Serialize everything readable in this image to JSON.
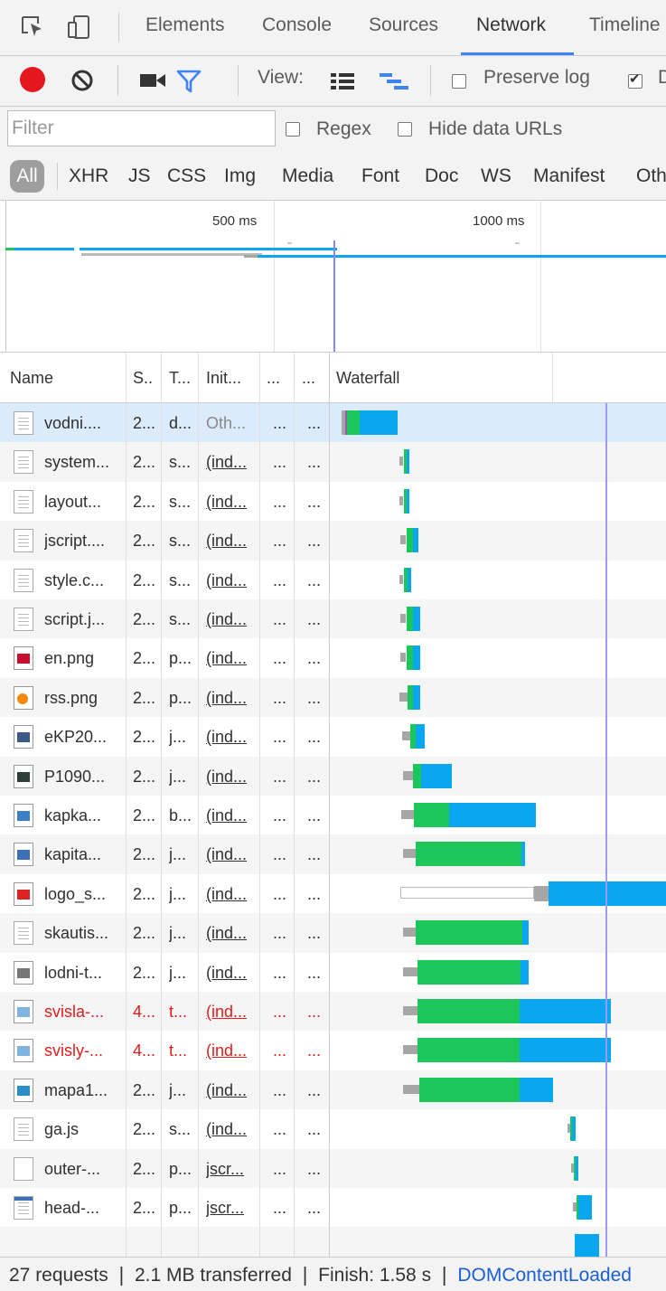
{
  "tabs": {
    "items": [
      "Elements",
      "Console",
      "Sources",
      "Network",
      "Timeline"
    ],
    "active": "Network"
  },
  "toolbar": {
    "view_label": "View:",
    "preserve_log_label": "Preserve log",
    "preserve_log_checked": false,
    "second_checkbox_checked": true,
    "second_checkbox_partial_label": "D",
    "record_color": "#e4171f",
    "filter_icon_color": "#3e82f7"
  },
  "filter": {
    "placeholder": "Filter",
    "value": "",
    "regex_label": "Regex",
    "hide_data_urls_label": "Hide data URLs"
  },
  "types": {
    "all_label": "All",
    "items": [
      "XHR",
      "JS",
      "CSS",
      "Img",
      "Media",
      "Font",
      "Doc",
      "WS",
      "Manifest",
      "Oth"
    ]
  },
  "overview": {
    "labels": [
      "500 ms",
      "1000 ms"
    ]
  },
  "table": {
    "headers": {
      "name": "Name",
      "status": "S..",
      "type": "T...",
      "initiator": "Init...",
      "size": "...",
      "time": "...",
      "waterfall": "Waterfall"
    },
    "rows": [
      {
        "name": "vodni....",
        "status": "2...",
        "type": "d...",
        "initiator": "Oth...",
        "size": "...",
        "time": "...",
        "icon": "document-icon",
        "error": false,
        "selected": true,
        "init_link": false,
        "wf": [
          [
            378,
            4,
            "#a6a6a6"
          ],
          [
            382,
            2,
            "#9b59b6"
          ],
          [
            384,
            14,
            "#1cc65a"
          ],
          [
            398,
            42,
            "#0aa6f0"
          ]
        ]
      },
      {
        "name": "system...",
        "status": "2...",
        "type": "s...",
        "initiator": "(ind...",
        "size": "...",
        "time": "...",
        "icon": "document-icon",
        "error": false,
        "init_link": true,
        "wf": [
          [
            442,
            4,
            "stub"
          ],
          [
            447,
            3,
            "#1cc65a"
          ],
          [
            450,
            3,
            "#0aa6f0"
          ]
        ]
      },
      {
        "name": "layout...",
        "status": "2...",
        "type": "s...",
        "initiator": "(ind...",
        "size": "...",
        "time": "...",
        "icon": "document-icon",
        "error": false,
        "init_link": true,
        "wf": [
          [
            442,
            4,
            "stub"
          ],
          [
            447,
            3,
            "#1cc65a"
          ],
          [
            450,
            3,
            "#0aa6f0"
          ]
        ]
      },
      {
        "name": "jscript....",
        "status": "2...",
        "type": "s...",
        "initiator": "(ind...",
        "size": "...",
        "time": "...",
        "icon": "document-icon",
        "error": false,
        "init_link": true,
        "wf": [
          [
            443,
            6,
            "stub"
          ],
          [
            450,
            7,
            "#1cc65a"
          ],
          [
            457,
            6,
            "#0aa6f0"
          ]
        ]
      },
      {
        "name": "style.c...",
        "status": "2...",
        "type": "s...",
        "initiator": "(ind...",
        "size": "...",
        "time": "...",
        "icon": "document-icon",
        "error": false,
        "init_link": true,
        "wf": [
          [
            442,
            4,
            "stub"
          ],
          [
            447,
            4,
            "#1cc65a"
          ],
          [
            451,
            4,
            "#0aa6f0"
          ]
        ]
      },
      {
        "name": "script.j...",
        "status": "2...",
        "type": "s...",
        "initiator": "(ind...",
        "size": "...",
        "time": "...",
        "icon": "document-icon",
        "error": false,
        "init_link": true,
        "wf": [
          [
            443,
            6,
            "stub"
          ],
          [
            450,
            7,
            "#1cc65a"
          ],
          [
            457,
            8,
            "#0aa6f0"
          ]
        ]
      },
      {
        "name": "en.png",
        "status": "2...",
        "type": "p...",
        "initiator": "(ind...",
        "size": "...",
        "time": "...",
        "icon": "flag-icon",
        "error": false,
        "init_link": true,
        "wf": [
          [
            443,
            6,
            "stub"
          ],
          [
            450,
            7,
            "#1cc65a"
          ],
          [
            457,
            8,
            "#0aa6f0"
          ]
        ]
      },
      {
        "name": "rss.png",
        "status": "2...",
        "type": "p...",
        "initiator": "(ind...",
        "size": "...",
        "time": "...",
        "icon": "rss-icon",
        "error": false,
        "init_link": true,
        "wf": [
          [
            442,
            9,
            "stub"
          ],
          [
            451,
            6,
            "#1cc65a"
          ],
          [
            457,
            8,
            "#0aa6f0"
          ]
        ]
      },
      {
        "name": "eKP20...",
        "status": "2...",
        "type": "j...",
        "initiator": "(ind...",
        "size": "...",
        "time": "...",
        "icon": "image-icon",
        "error": false,
        "init_link": true,
        "wf": [
          [
            445,
            9,
            "stub"
          ],
          [
            454,
            6,
            "#1cc65a"
          ],
          [
            460,
            10,
            "#0aa6f0"
          ]
        ]
      },
      {
        "name": "P1090...",
        "status": "2...",
        "type": "j...",
        "initiator": "(ind...",
        "size": "...",
        "time": "...",
        "icon": "photo-icon",
        "error": false,
        "init_link": true,
        "wf": [
          [
            446,
            11,
            "stub"
          ],
          [
            457,
            9,
            "#1cc65a"
          ],
          [
            466,
            34,
            "#0aa6f0"
          ]
        ]
      },
      {
        "name": "kapka...",
        "status": "2...",
        "type": "b...",
        "initiator": "(ind...",
        "size": "...",
        "time": "...",
        "icon": "drop-icon",
        "error": false,
        "init_link": true,
        "wf": [
          [
            444,
            14,
            "stub"
          ],
          [
            458,
            39,
            "#1cc65a"
          ],
          [
            497,
            96,
            "#0aa6f0"
          ]
        ]
      },
      {
        "name": "kapita...",
        "status": "2...",
        "type": "j...",
        "initiator": "(ind...",
        "size": "...",
        "time": "...",
        "icon": "badge-icon",
        "error": false,
        "init_link": true,
        "wf": [
          [
            446,
            14,
            "stub"
          ],
          [
            460,
            117,
            "#1cc65a"
          ],
          [
            577,
            4,
            "#0aa6f0"
          ]
        ]
      },
      {
        "name": "logo_s...",
        "status": "2...",
        "type": "j...",
        "initiator": "(ind...",
        "size": "...",
        "time": "...",
        "icon": "logo-icon",
        "error": false,
        "init_link": true,
        "wf": [
          [
            443,
            148,
            "queued"
          ],
          [
            591,
            16,
            "stub-tall"
          ],
          [
            607,
            130,
            "#0aa6f0"
          ]
        ]
      },
      {
        "name": "skautis...",
        "status": "2...",
        "type": "j...",
        "initiator": "(ind...",
        "size": "...",
        "time": "...",
        "icon": "document-icon",
        "error": false,
        "init_link": true,
        "wf": [
          [
            446,
            14,
            "stub"
          ],
          [
            460,
            118,
            "#1cc65a"
          ],
          [
            578,
            7,
            "#0aa6f0"
          ]
        ]
      },
      {
        "name": "lodni-t...",
        "status": "2...",
        "type": "j...",
        "initiator": "(ind...",
        "size": "...",
        "time": "...",
        "icon": "ship-icon",
        "error": false,
        "init_link": true,
        "wf": [
          [
            446,
            16,
            "stub"
          ],
          [
            462,
            114,
            "#1cc65a"
          ],
          [
            576,
            9,
            "#0aa6f0"
          ]
        ]
      },
      {
        "name": "svisla-...",
        "status": "4...",
        "type": "t...",
        "initiator": "(ind...",
        "size": "...",
        "time": "...",
        "icon": "broken-image-icon",
        "error": true,
        "init_link": true,
        "wf": [
          [
            446,
            16,
            "stub"
          ],
          [
            462,
            113,
            "#1cc65a"
          ],
          [
            575,
            101,
            "#0aa6f0"
          ]
        ]
      },
      {
        "name": "svisly-...",
        "status": "4...",
        "type": "t...",
        "initiator": "(ind...",
        "size": "...",
        "time": "...",
        "icon": "broken-image-icon",
        "error": true,
        "init_link": true,
        "wf": [
          [
            446,
            16,
            "stub"
          ],
          [
            462,
            113,
            "#1cc65a"
          ],
          [
            575,
            101,
            "#0aa6f0"
          ]
        ]
      },
      {
        "name": "mapa1...",
        "status": "2...",
        "type": "j...",
        "initiator": "(ind...",
        "size": "...",
        "time": "...",
        "icon": "map-icon",
        "error": false,
        "init_link": true,
        "wf": [
          [
            446,
            18,
            "stub"
          ],
          [
            464,
            111,
            "#1cc65a"
          ],
          [
            575,
            37,
            "#0aa6f0"
          ]
        ]
      },
      {
        "name": "ga.js",
        "status": "2...",
        "type": "s...",
        "initiator": "(ind...",
        "size": "...",
        "time": "...",
        "icon": "document-icon",
        "error": false,
        "init_link": true,
        "wf": [
          [
            628,
            3,
            "stub"
          ],
          [
            631,
            2,
            "#1cc65a"
          ],
          [
            633,
            4,
            "#0aa6f0"
          ]
        ]
      },
      {
        "name": "outer-...",
        "status": "2...",
        "type": "p...",
        "initiator": "jscr...",
        "size": "...",
        "time": "...",
        "icon": "blank-icon",
        "error": false,
        "init_link": true,
        "wf": [
          [
            632,
            3,
            "stub"
          ],
          [
            635,
            2,
            "#1cc65a"
          ],
          [
            637,
            3,
            "#0aa6f0"
          ]
        ]
      },
      {
        "name": "head-...",
        "status": "2...",
        "type": "p...",
        "initiator": "jscr...",
        "size": "...",
        "time": "...",
        "icon": "window-icon",
        "error": false,
        "init_link": true,
        "wf": [
          [
            634,
            4,
            "stub"
          ],
          [
            638,
            2,
            "#1cc65a"
          ],
          [
            640,
            15,
            "#0aa6f0"
          ]
        ]
      },
      {
        "name": "",
        "status": "",
        "type": "",
        "initiator": "",
        "size": "",
        "time": "",
        "icon": "partial",
        "error": false,
        "init_link": false,
        "wf": [
          [
            636,
            27,
            "#0aa6f0"
          ]
        ]
      }
    ]
  },
  "status": {
    "summary": "27 requests  ❘  2.1 MB transferred  ❘  Finish: 1.58 s  ❘  ",
    "dcl": "DOMContentLoaded"
  }
}
